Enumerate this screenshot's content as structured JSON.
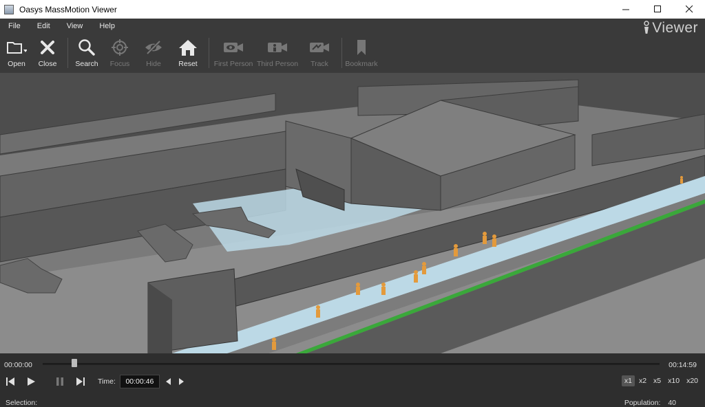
{
  "window": {
    "title": "Oasys MassMotion Viewer",
    "controls": {
      "minimize": "—",
      "maximize": "☐",
      "close": "✕"
    }
  },
  "menu": [
    "File",
    "Edit",
    "View",
    "Help"
  ],
  "brand": {
    "text": "Viewer"
  },
  "toolbar": {
    "buttons": [
      {
        "label": "Open",
        "icon": "folder-icon",
        "enabled": true
      },
      {
        "label": "Close",
        "icon": "close-x-icon",
        "enabled": true
      },
      {
        "label": "Search",
        "icon": "search-icon",
        "enabled": true
      },
      {
        "label": "Focus",
        "icon": "crosshair-icon",
        "enabled": false
      },
      {
        "label": "Hide",
        "icon": "eye-slash-icon",
        "enabled": false
      },
      {
        "label": "Reset",
        "icon": "home-icon",
        "enabled": true
      },
      {
        "label": "First Person",
        "icon": "camera-eye-icon",
        "enabled": false
      },
      {
        "label": "Third Person",
        "icon": "camera-person-icon",
        "enabled": false
      },
      {
        "label": "Track",
        "icon": "camera-track-icon",
        "enabled": false
      },
      {
        "label": "Bookmark",
        "icon": "bookmark-icon",
        "enabled": false
      }
    ]
  },
  "colors": {
    "agent": "#e39a3c",
    "floor_blue": "#b9dbea",
    "rail_green": "#3aa83a",
    "wall": "#6b6b6b",
    "background": "#4d4d4d"
  },
  "timeline": {
    "start": "00:00:00",
    "end": "00:14:59",
    "progress_fraction": 0.051,
    "time_label": "Time:",
    "current_time": "00:00:46",
    "speeds": [
      "x1",
      "x2",
      "x5",
      "x10",
      "x20"
    ],
    "active_speed": "x1"
  },
  "status": {
    "selection_label": "Selection:",
    "population_label": "Population:",
    "population_value": "40"
  }
}
